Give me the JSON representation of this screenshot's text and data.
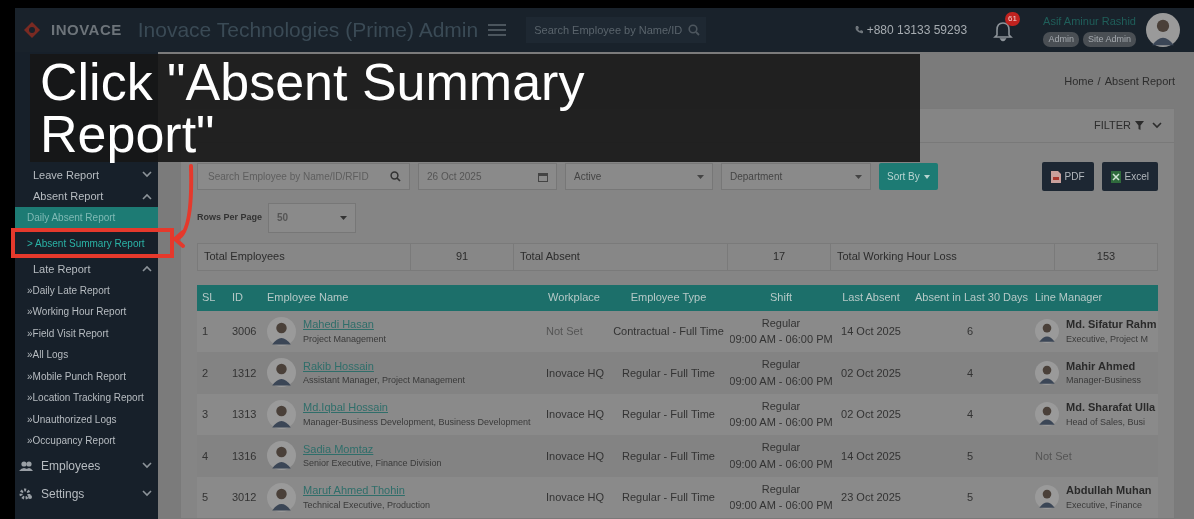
{
  "header": {
    "brand": "INOVACE",
    "title": "Inovace Technologies (Prime) Admin",
    "search": {
      "placeholder": "Search Employee by Name/ID"
    },
    "phone": "+880 13133 59293",
    "notifications": "61",
    "user": {
      "name": "Asif Aminur Rashid",
      "roles": [
        "Admin",
        "Site Admin"
      ]
    }
  },
  "sidebar": {
    "items": [
      {
        "kind": "group",
        "label": "Leave Report",
        "expanded": false
      },
      {
        "kind": "group",
        "label": "Absent Report",
        "expanded": true,
        "children": [
          {
            "label": "Daily Absent Report",
            "selected": true,
            "hovered": false
          },
          {
            "label": "> Absent Summary Report",
            "selected": false,
            "hovered": true
          }
        ]
      },
      {
        "kind": "group",
        "label": "Late Report",
        "expanded": true,
        "children": [
          {
            "label": "»Daily Late Report",
            "selected": false,
            "hovered": false
          },
          {
            "label": "»Working Hour Report",
            "selected": false,
            "hovered": false
          },
          {
            "label": "»Field Visit Report",
            "selected": false,
            "hovered": false
          },
          {
            "label": "»All Logs",
            "selected": false,
            "hovered": false
          },
          {
            "label": "»Mobile Punch Report",
            "selected": false,
            "hovered": false
          },
          {
            "label": "»Location Tracking Report",
            "selected": false,
            "hovered": false
          },
          {
            "label": "»Unauthorized Logs",
            "selected": false,
            "hovered": false
          },
          {
            "label": "»Occupancy Report",
            "selected": false,
            "hovered": false
          }
        ]
      },
      {
        "kind": "section",
        "label": "Employees",
        "expanded": false
      },
      {
        "kind": "section",
        "label": "Settings",
        "expanded": false
      }
    ]
  },
  "breadcrumb": [
    "Home",
    "Absent Report"
  ],
  "breadcrumb_separator": "/",
  "card": {
    "filter_label": "FILTER",
    "filters": {
      "search_placeholder": "Search Employee by Name/ID/RFID",
      "date": "26 Oct 2025",
      "status": "Active",
      "department_placeholder": "Department",
      "sort_button": "Sort By"
    },
    "exports": [
      "PDF",
      "Excel"
    ],
    "rows_per_page": {
      "label": "Rows Per Page",
      "value": "50"
    },
    "summary": [
      {
        "label": "Total Employees",
        "value": "91"
      },
      {
        "label": "Total Absent",
        "value": "17"
      },
      {
        "label": "Total Working Hour Loss",
        "value": "153"
      }
    ],
    "table": {
      "columns": [
        "SL",
        "ID",
        "Employee Name",
        "Workplace",
        "Employee Type",
        "Shift",
        "Last Absent",
        "Absent in Last 30 Days",
        "Line Manager"
      ],
      "rows": [
        {
          "sl": "1",
          "id": "3006",
          "name": "Mahedi Hasan",
          "designation": "Project Management",
          "workplace": {
            "text": "Not Set",
            "set": false
          },
          "type": "Contractual - Full Time",
          "shift": "Regular",
          "shift_time": "09:00 AM - 06:00 PM",
          "last_absent": "14 Oct 2025",
          "absent_30": "6",
          "line_manager": {
            "set": true,
            "name": "Md. Sifatur Rahm",
            "role": "Executive, Project M"
          }
        },
        {
          "sl": "2",
          "id": "1312",
          "name": "Rakib Hossain",
          "designation": "Assistant Manager, Project Management",
          "workplace": {
            "text": "Inovace HQ",
            "set": true
          },
          "type": "Regular - Full Time",
          "shift": "Regular",
          "shift_time": "09:00 AM - 06:00 PM",
          "last_absent": "02 Oct 2025",
          "absent_30": "4",
          "line_manager": {
            "set": true,
            "name": "Mahir Ahmed",
            "role": "Manager-Business"
          }
        },
        {
          "sl": "3",
          "id": "1313",
          "name": "Md.Iqbal Hossain",
          "designation": "Manager-Business Development, Business Development",
          "workplace": {
            "text": "Inovace HQ",
            "set": true
          },
          "type": "Regular - Full Time",
          "shift": "Regular",
          "shift_time": "09:00 AM - 06:00 PM",
          "last_absent": "02 Oct 2025",
          "absent_30": "4",
          "line_manager": {
            "set": true,
            "name": "Md. Sharafat Ulla",
            "role": "Head of Sales, Busi"
          }
        },
        {
          "sl": "4",
          "id": "1316",
          "name": "Sadia Momtaz",
          "designation": "Senior Executive, Finance Division",
          "workplace": {
            "text": "Inovace HQ",
            "set": true
          },
          "type": "Regular - Full Time",
          "shift": "Regular",
          "shift_time": "09:00 AM - 06:00 PM",
          "last_absent": "14 Oct 2025",
          "absent_30": "5",
          "line_manager": {
            "set": false,
            "name": "Not Set"
          }
        },
        {
          "sl": "5",
          "id": "3012",
          "name": "Maruf Ahmed Thohin",
          "designation": "Technical Executive, Production",
          "workplace": {
            "text": "Inovace HQ",
            "set": true
          },
          "type": "Regular - Full Time",
          "shift": "Regular",
          "shift_time": "09:00 AM - 06:00 PM",
          "last_absent": "23 Oct 2025",
          "absent_30": "5",
          "line_manager": {
            "set": true,
            "name": "Abdullah Muhan",
            "role": "Executive, Finance"
          }
        }
      ]
    }
  },
  "overlay": {
    "caption": "Click \"Absent Summary Report\""
  }
}
